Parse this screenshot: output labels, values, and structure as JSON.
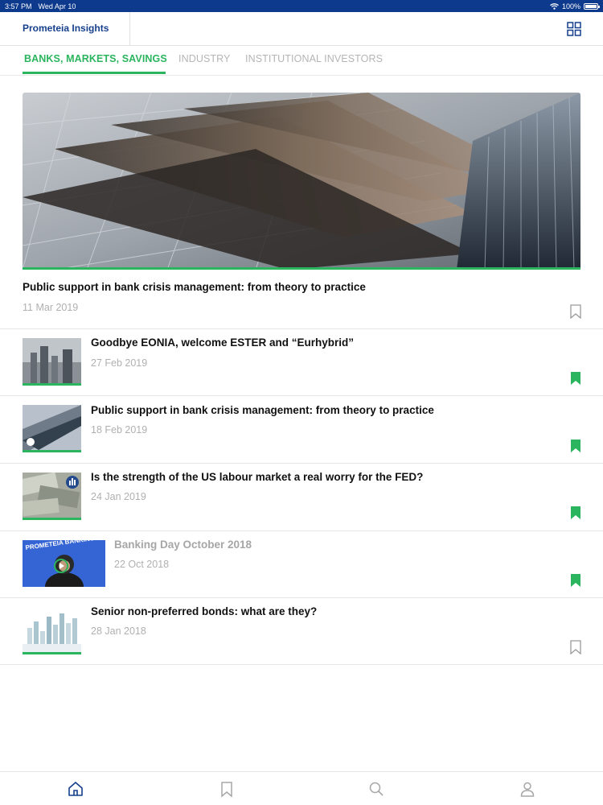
{
  "status_bar": {
    "time": "3:57 PM",
    "date": "Wed Apr 10",
    "battery": "100%",
    "battery_level": 1.0
  },
  "app": {
    "title": "Prometeia Insights"
  },
  "tabs": [
    {
      "label": "BANKS, MARKETS, SAVINGS",
      "active": true
    },
    {
      "label": "INDUSTRY",
      "active": false
    },
    {
      "label": "INSTITUTIONAL INVESTORS",
      "active": false
    }
  ],
  "featured": {
    "title": "Public support in bank crisis management: from theory to practice",
    "date": "11 Mar 2019",
    "bookmarked": false
  },
  "articles": [
    {
      "title": "Goodbye EONIA, welcome ESTER and “Eurhybrid”",
      "date": "27 Feb 2019",
      "bookmarked": true
    },
    {
      "title": "Public support in bank crisis management: from theory to practice",
      "date": "18 Feb 2019",
      "bookmarked": true
    },
    {
      "title": "Is the strength of the US labour market a real worry for the FED?",
      "date": "24 Jan 2019",
      "bookmarked": true
    },
    {
      "title": "Banking Day October 2018",
      "date": "22 Oct 2018",
      "bookmarked": true,
      "thumb_text": "PROMETEIA BANKING DAY"
    },
    {
      "title": "Senior non-preferred bonds: what are they?",
      "date": "28 Jan 2018",
      "bookmarked": false
    }
  ],
  "colors": {
    "accent": "#2bb55e",
    "brand": "#163f8c",
    "status_bar": "#0d3a8c"
  },
  "icons": {
    "grid": "grid-icon",
    "bookmark": "bookmark-icon",
    "home": "home-icon",
    "search": "search-icon",
    "profile": "user-icon",
    "wifi": "wifi-icon",
    "battery": "battery-icon"
  }
}
